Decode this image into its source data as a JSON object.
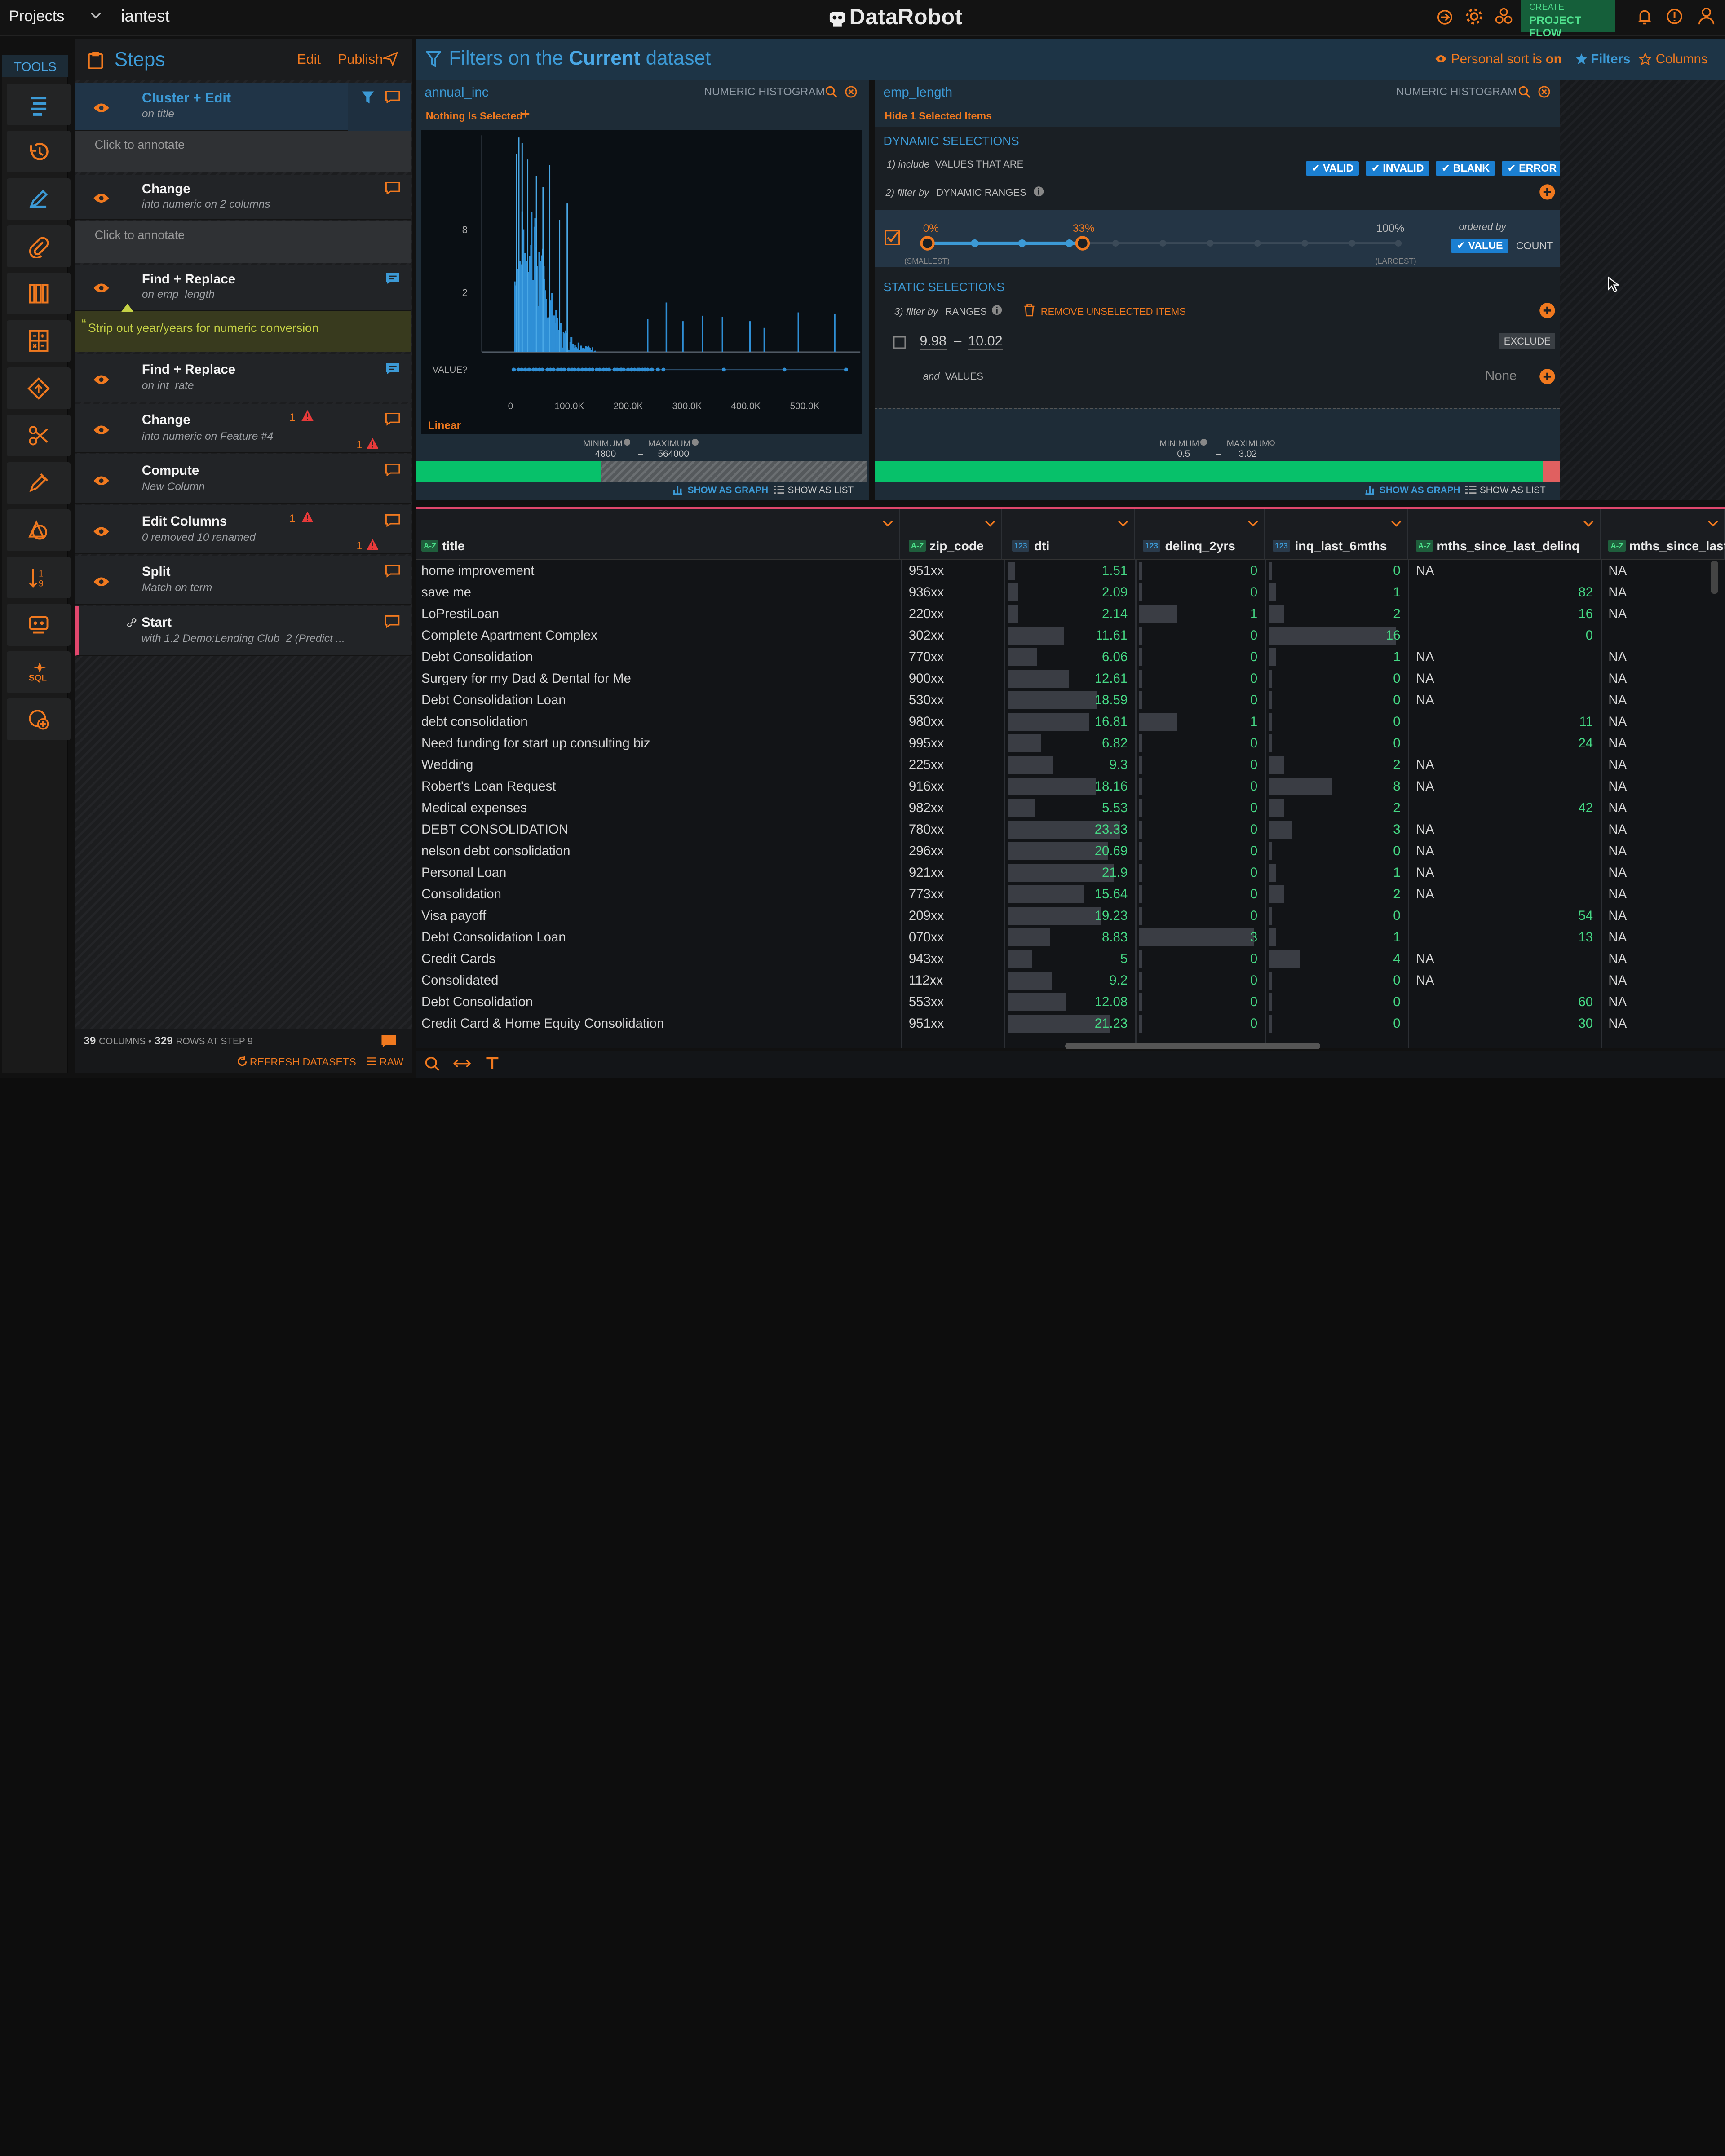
{
  "topbar": {
    "projects_label": "Projects",
    "project_name": "iantest",
    "brand": "DataRobot",
    "create_label": "CREATE",
    "flow_label": "PROJECT FLOW"
  },
  "tools": {
    "header": "TOOLS"
  },
  "steps": {
    "header": "Steps",
    "edit": "Edit",
    "publish": "Publish",
    "items": [
      {
        "title": "Cluster + Edit",
        "sub": "on title",
        "annot": "Click to annotate"
      },
      {
        "title": "Change",
        "sub": "into numeric on 2 columns",
        "annot": "Click to annotate"
      },
      {
        "title": "Find + Replace",
        "sub": "on emp_length",
        "note": "Strip out year/years for numeric conversion"
      },
      {
        "title": "Find + Replace",
        "sub": "on int_rate"
      },
      {
        "title": "Change",
        "sub": "into numeric on Feature #4",
        "warn1": "1",
        "warn2": "1"
      },
      {
        "title": "Compute",
        "sub": "New Column"
      },
      {
        "title": "Edit Columns",
        "sub": "0 removed 10 renamed",
        "warn1": "1",
        "warn2": "1"
      },
      {
        "title": "Split",
        "sub": "Match on term"
      },
      {
        "title": "Start",
        "sub": "with 1.2 Demo:Lending Club_2 (Predict ..."
      }
    ],
    "footer_columns": "39",
    "footer_rows": "329",
    "footer_text1": "COLUMNS •",
    "footer_text2": "ROWS AT STEP 9",
    "refresh": "REFRESH DATASETS",
    "raw": "RAW"
  },
  "filters": {
    "title_pre": "Filters on the",
    "title_bold": "Current",
    "title_post": "dataset",
    "personal_sort": "Personal sort is",
    "personal_on": "on",
    "filters_btn": "Filters",
    "columns_btn": "Columns"
  },
  "annual_inc": {
    "name": "annual_inc",
    "type": "NUMERIC HISTOGRAM",
    "selection": "Nothing Is Selected",
    "yticks": [
      "8",
      "2"
    ],
    "value_label": "VALUE?",
    "xticks": [
      "0",
      "100.0K",
      "200.0K",
      "300.0K",
      "400.0K",
      "500.0K"
    ],
    "scale": "Linear",
    "min_label": "MINIMUM",
    "max_label": "MAXIMUM",
    "min": "4800",
    "max": "564000",
    "dash": "–",
    "graph_btn": "SHOW AS GRAPH",
    "list_btn": "SHOW AS LIST"
  },
  "emp_length": {
    "name": "emp_length",
    "type": "NUMERIC HISTOGRAM",
    "hide": "Hide 1 Selected Items",
    "dyn_header": "DYNAMIC SELECTIONS",
    "include": "1) include",
    "values_that_are": "VALUES THAT ARE",
    "checks": [
      "VALID",
      "INVALID",
      "BLANK",
      "ERROR"
    ],
    "filter_by": "2) filter by",
    "dyn_ranges": "DYNAMIC RANGES",
    "pct0": "0%",
    "pct33": "33%",
    "pct100": "100%",
    "smallest": "(SMALLEST)",
    "largest": "(LARGEST)",
    "ordered_by": "ordered by",
    "value_btn": "VALUE",
    "count_btn": "COUNT",
    "static_header": "STATIC SELECTIONS",
    "filter_by3": "3) filter by",
    "ranges": "RANGES",
    "remove": "REMOVE UNSELECTED ITEMS",
    "range_lo": "9.98",
    "range_hi": "10.02",
    "exclude": "EXCLUDE",
    "and": "and",
    "values": "VALUES",
    "none": "None",
    "min_label": "MINIMUM",
    "max_label": "MAXIMUM",
    "min": "0.5",
    "max": "3.02",
    "dash": "–",
    "graph_btn": "SHOW AS GRAPH",
    "list_btn": "SHOW AS LIST"
  },
  "grid": {
    "columns": [
      {
        "type": "A-Z",
        "name": "title"
      },
      {
        "type": "A-Z",
        "name": "zip_code"
      },
      {
        "type": "123",
        "name": "dti"
      },
      {
        "type": "123",
        "name": "delinq_2yrs"
      },
      {
        "type": "123",
        "name": "inq_last_6mths"
      },
      {
        "type": "A-Z",
        "name": "mths_since_last_delinq"
      },
      {
        "type": "A-Z",
        "name": "mths_since_last_"
      }
    ],
    "rows": [
      [
        "home improvement",
        "951xx",
        "1.51",
        "0",
        "0",
        "NA",
        "NA"
      ],
      [
        "save me",
        "936xx",
        "2.09",
        "0",
        "1",
        "82",
        "NA"
      ],
      [
        "LoPrestiLoan",
        "220xx",
        "2.14",
        "1",
        "2",
        "16",
        "NA"
      ],
      [
        "Complete Apartment Complex",
        "302xx",
        "11.61",
        "0",
        "16",
        "0",
        ""
      ],
      [
        "Debt Consolidation",
        "770xx",
        "6.06",
        "0",
        "1",
        "NA",
        "NA"
      ],
      [
        "Surgery for my Dad & Dental for Me",
        "900xx",
        "12.61",
        "0",
        "0",
        "NA",
        "NA"
      ],
      [
        "Debt Consolidation Loan",
        "530xx",
        "18.59",
        "0",
        "0",
        "NA",
        "NA"
      ],
      [
        "debt consolidation",
        "980xx",
        "16.81",
        "1",
        "0",
        "11",
        "NA"
      ],
      [
        "Need funding for start up consulting biz",
        "995xx",
        "6.82",
        "0",
        "0",
        "24",
        "NA"
      ],
      [
        "Wedding",
        "225xx",
        "9.3",
        "0",
        "2",
        "NA",
        "NA"
      ],
      [
        "Robert's Loan Request",
        "916xx",
        "18.16",
        "0",
        "8",
        "NA",
        "NA"
      ],
      [
        "Medical expenses",
        "982xx",
        "5.53",
        "0",
        "2",
        "42",
        "NA"
      ],
      [
        "DEBT CONSOLIDATION",
        "780xx",
        "23.33",
        "0",
        "3",
        "NA",
        "NA"
      ],
      [
        "nelson debt consolidation",
        "296xx",
        "20.69",
        "0",
        "0",
        "NA",
        "NA"
      ],
      [
        "Personal Loan",
        "921xx",
        "21.9",
        "0",
        "1",
        "NA",
        "NA"
      ],
      [
        "Consolidation",
        "773xx",
        "15.64",
        "0",
        "2",
        "NA",
        "NA"
      ],
      [
        "Visa payoff",
        "209xx",
        "19.23",
        "0",
        "0",
        "54",
        "NA"
      ],
      [
        "Debt Consolidation Loan",
        "070xx",
        "8.83",
        "3",
        "1",
        "13",
        "NA"
      ],
      [
        "Credit Cards",
        "943xx",
        "5",
        "0",
        "4",
        "NA",
        "NA"
      ],
      [
        "Consolidated",
        "112xx",
        "9.2",
        "0",
        "0",
        "NA",
        "NA"
      ],
      [
        "Debt Consolidation",
        "553xx",
        "12.08",
        "0",
        "0",
        "60",
        "NA"
      ],
      [
        "Credit Card & Home Equity Consolidation",
        "951xx",
        "21.23",
        "0",
        "0",
        "30",
        "NA"
      ]
    ]
  },
  "colors": {
    "accent": "#f0791f",
    "blue": "#3c9ad6",
    "green": "#45d884",
    "valid_bar": "#07c16a"
  }
}
